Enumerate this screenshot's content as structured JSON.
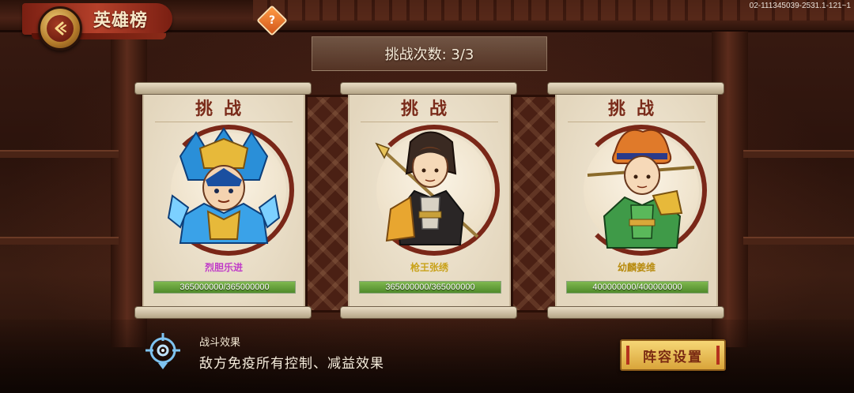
{
  "header": {
    "title": "英雄榜",
    "help_label": "?",
    "build_id": "02-111345039-2531.1-121~1",
    "challenge_count": "挑战次数: 3/3"
  },
  "cards": [
    {
      "head": "挑战",
      "name": "烈胆乐进",
      "name_color": "#c03cc8",
      "hp_text": "365000000/365000000",
      "hp_fraction": 1.0,
      "theme": "blue-armor"
    },
    {
      "head": "挑战",
      "name": "枪王张绣",
      "name_color": "#c9a21a",
      "hp_text": "365000000/365000000",
      "hp_fraction": 1.0,
      "theme": "black-gold"
    },
    {
      "head": "挑战",
      "name": "幼麟姜维",
      "name_color": "#b88c10",
      "hp_text": "400000000/400000000",
      "hp_fraction": 1.0,
      "theme": "green-armor"
    }
  ],
  "battle_effect": {
    "title": "战斗效果",
    "description": "敌方免疫所有控制、减益效果",
    "icon": "target-icon"
  },
  "lineup_button": "阵容设置",
  "colors": {
    "accent_red": "#7a2718",
    "hp_green": "#5f9a35",
    "gold": "#f0c85a"
  }
}
